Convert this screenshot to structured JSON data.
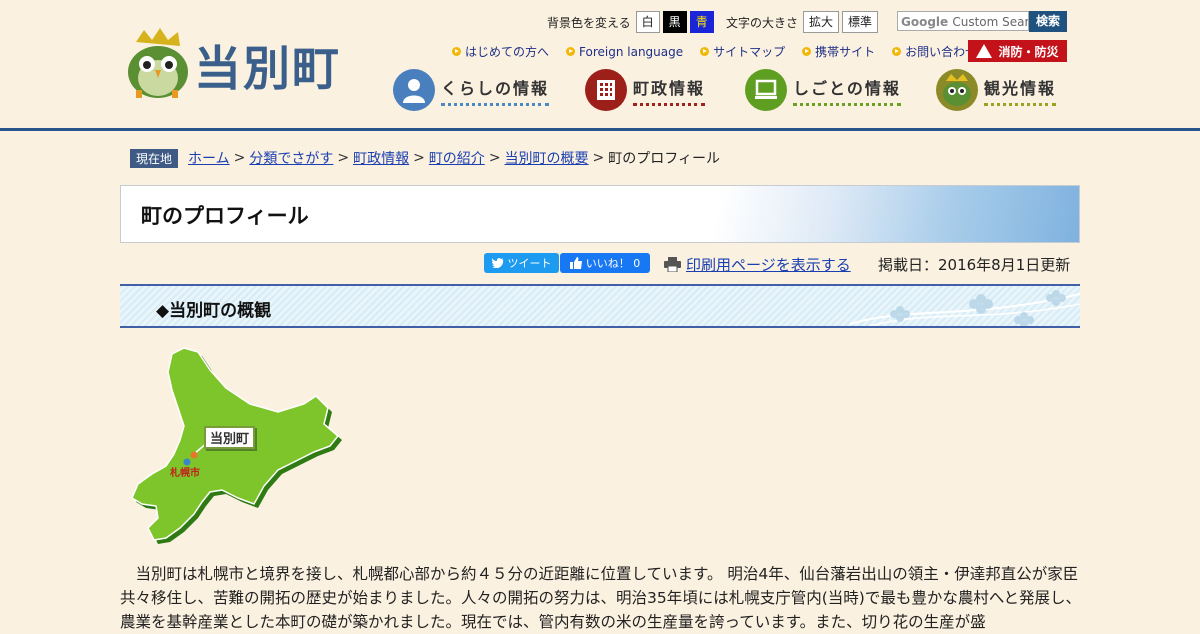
{
  "header": {
    "logo_text": "当別町",
    "bg_color_label": "背景色を変える",
    "bg_white": "白",
    "bg_black": "黒",
    "bg_blue": "青",
    "font_size_label": "文字の大きさ",
    "font_enlarge": "拡大",
    "font_standard": "標準",
    "search_placeholder": "Custom Search",
    "search_button": "検索",
    "sublinks": [
      "はじめての方へ",
      "Foreign language",
      "サイトマップ",
      "携帯サイト",
      "お問い合わせ"
    ],
    "disaster_label": "消防・防災",
    "gnav": [
      "くらしの情報",
      "町政情報",
      "しごとの情報",
      "観光情報"
    ]
  },
  "breadcrumb": {
    "here_label": "現在地",
    "items": [
      "ホーム",
      "分類でさがす",
      "町政情報",
      "町の紹介",
      "当別町の概要"
    ],
    "current": "町のプロフィール"
  },
  "page": {
    "title": "町のプロフィール",
    "tweet_label": "ツイート",
    "like_label": "いいね！ 0",
    "print_label": "印刷用ページを表示する",
    "date_label": "掲載日：2016年8月1日更新",
    "section_heading": "◆当別町の概観"
  },
  "map": {
    "town_label": "当別町",
    "city_label": "札幌市"
  },
  "body": {
    "paragraph": "　当別町は札幌市と境界を接し、札幌都心部から約４５分の近距離に位置しています。 明治4年、仙台藩岩出山の領主・伊達邦直公が家臣共々移住し、苦難の開拓の歴史が始まりました。人々の開拓の努力は、明治35年頃には札幌支庁管内(当時)で最も豊かな農村へと発展し、農業を基幹産業とした本町の礎が築かれました。現在では、管内有数の米の生産量を誇っています。また、切り花の生産が盛"
  },
  "colors": {
    "background": "#fbf1e1",
    "header_line": "#27558c",
    "link": "#1a3fb0",
    "disaster": "#c4121b",
    "map_green": "#7dc52a"
  }
}
